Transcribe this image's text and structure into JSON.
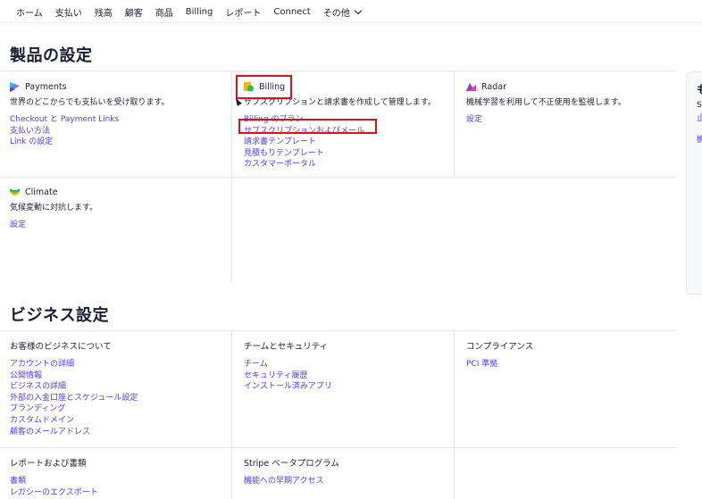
{
  "nav": {
    "items": [
      "ホーム",
      "支払い",
      "残高",
      "顧客",
      "商品",
      "Billing",
      "レポート",
      "Connect",
      "その他"
    ]
  },
  "product_settings": {
    "title": "製品の設定",
    "payments": {
      "name": "Payments",
      "icon": "payments-icon",
      "desc": "世界のどこからでも支払いを受け取ります。",
      "links": [
        "Checkout と Payment Links",
        "支払い方法",
        "Link の設定"
      ]
    },
    "billing": {
      "name": "Billing",
      "icon": "billing-icon",
      "desc": "サブスクリプションと請求書を作成して管理します。",
      "links": [
        "Billing のプラン",
        "サブスクリプションおよびメール",
        "請求書テンプレート",
        "見積もりテンプレート",
        "カスタマーポータル"
      ]
    },
    "radar": {
      "name": "Radar",
      "icon": "radar-icon",
      "desc": "機械学習を利用して不正使用を監視します。",
      "links": [
        "設定"
      ]
    },
    "climate": {
      "name": "Climate",
      "icon": "climate-icon",
      "desc": "気候変動に対抗します。",
      "links": [
        "設定"
      ]
    }
  },
  "side_card": {
    "title": "も",
    "text": "S",
    "link1": "止",
    "link2": "機"
  },
  "business_settings": {
    "title": "ビジネス設定",
    "about": {
      "title": "お客様のビジネスについて",
      "links": [
        "アカウントの詳細",
        "公開情報",
        "ビジネスの詳細",
        "外部の入金口座とスケジュール設定",
        "ブランディング",
        "カスタムドメイン",
        "顧客のメールアドレス"
      ]
    },
    "team": {
      "title": "チームとセキュリティ",
      "links": [
        "チーム",
        "セキュリティ履歴",
        "インストール済みアプリ"
      ]
    },
    "compliance": {
      "title": "コンプライアンス",
      "links": [
        "PCI 準拠"
      ]
    },
    "reports": {
      "title": "レポートおよび書類",
      "links": [
        "書類",
        "レガシーのエクスポート"
      ]
    },
    "beta": {
      "title": "Stripe ベータプログラム",
      "links": [
        "機能への早期アクセス"
      ]
    }
  },
  "colors": {
    "link": "#533afd",
    "highlight": "#d4141f",
    "text": "#1a1f36"
  }
}
